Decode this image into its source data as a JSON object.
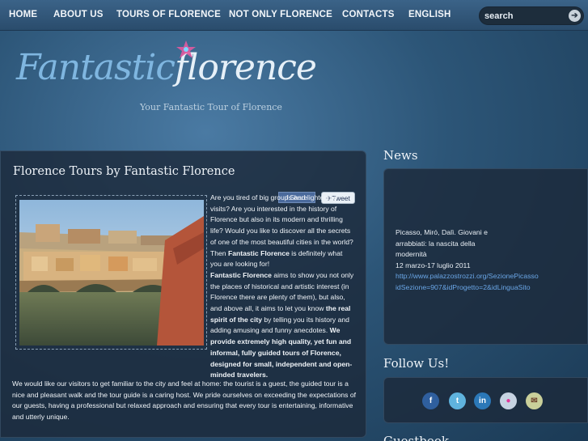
{
  "nav": {
    "items": [
      "HOME",
      "ABOUT US",
      "TOURS OF FLORENCE",
      "NOT ONLY FLORENCE",
      "CONTACTS",
      "ENGLISH"
    ],
    "search_placeholder": "search"
  },
  "logo": {
    "part1": "Fantastic",
    "part2": "florence",
    "tagline": "Your Fantastic Tour of Florence"
  },
  "main": {
    "title": "Florence Tours by Fantastic Florence",
    "share_label": "Share",
    "tweet_label": "Tweet",
    "p1_a": "Are you tired of big groups and lightening visits? Are you interested in the history of Florence but also in its modern and thrilling life? Would you like to discover all the secrets of one of the most beautiful cities in the world? Then ",
    "p1_b": "Fantastic Florence",
    "p1_c": " is definitely what you are looking for!",
    "p2_a": "Fantastic Florence",
    "p2_b": " aims to show you not only the places of historical and artistic interest (in Florence there are plenty of them), but also, and above all, it aims to let you know ",
    "p2_c": "the real spirit of the city",
    "p2_d": " by telling you its history and adding amusing and funny anecdotes. ",
    "p2_e": "We provide extremely high quality, yet fun and informal, fully guided tours of Florence, designed for small, independent and open-minded travelers.",
    "p3": "We would like our visitors to get familiar to the city and feel at home: the tourist is a guest, the guided tour is a nice and pleasant walk and the tour guide is a caring host. We pride ourselves on exceeding the expectations of our guests, having a professional but relaxed approach and ensuring that every tour is entertaining, informative and utterly unique."
  },
  "news": {
    "title": "News",
    "line1": "Picasso, Miró, Dalì. Giovani e",
    "line2": "arrabbiati: la nascita della",
    "line3": "modernità",
    "line4": "12 marzo-17 luglio 2011",
    "link1": "http://www.palazzostrozzi.org/SezionePicasso",
    "link2": "idSezione=907&idProgetto=2&idLinguaSito"
  },
  "follow": {
    "title": "Follow Us!",
    "icons": [
      "facebook-icon",
      "twitter-icon",
      "linkedin-icon",
      "flickr-icon",
      "email-icon"
    ]
  },
  "guestbook": {
    "title": "Guestbook"
  },
  "colors": {
    "accent_link": "#6aa6e6",
    "panel": "#1c2a3a"
  }
}
